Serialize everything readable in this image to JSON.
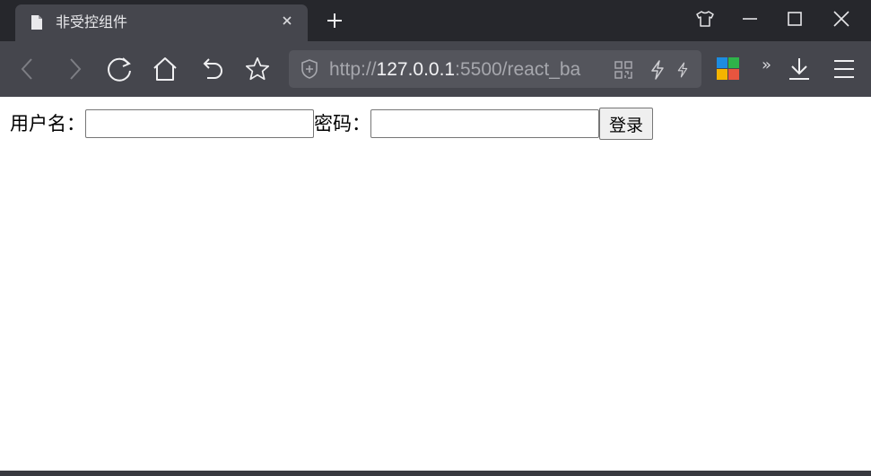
{
  "browser": {
    "tab": {
      "title": "非受控组件",
      "icon": "document-icon"
    },
    "toolbar": {
      "url_prefix": "http://",
      "url_host": "127.0.0.1",
      "url_rest": ":5500/react_ba",
      "icons": [
        "back-icon",
        "forward-icon",
        "reload-icon",
        "home-icon",
        "undo-icon",
        "star-icon",
        "qr-code-icon",
        "lightning-icon",
        "extensions-icon",
        "more-chevron-icon",
        "download-icon",
        "menu-icon"
      ]
    },
    "window_controls": [
      "skin-icon",
      "minimize-icon",
      "maximize-icon",
      "close-icon"
    ],
    "colors": {
      "tabstrip": "#26272c",
      "toolbar": "#45464d",
      "urlbar": "#54555c",
      "ext_blue": "#1d8ce0",
      "ext_green": "#2fb34a",
      "ext_yellow": "#f4b400",
      "ext_red": "#e8553f"
    }
  },
  "form": {
    "username_label": "用户名：",
    "username_value": "",
    "password_label": "密码：",
    "password_value": "",
    "submit_label": "登录"
  }
}
